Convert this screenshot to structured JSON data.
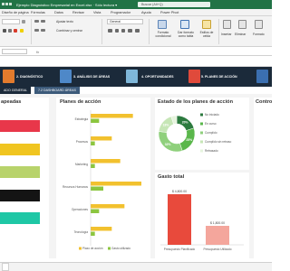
{
  "window": {
    "title": "Ejemplo Diagnóstico Empresarial en Excel.xlsx  ·  Sólo lectura ▾",
    "search_placeholder": "Buscar (Alt+Q)"
  },
  "ribbon_tabs": [
    "Diseño de página",
    "Fórmulas",
    "Datos",
    "Revisar",
    "Vista",
    "Programador",
    "Ayuda",
    "Power Pivot"
  ],
  "ribbon": {
    "font_name": "",
    "wrap_text": "Ajustar texto",
    "merge_center": "Combinar y centrar",
    "number_format": "General",
    "cond_format": "Formato condicional",
    "format_table": "Dar formato como tabla",
    "cell_styles": "Estilos de celda",
    "insert": "Insertar",
    "delete": "Eliminar",
    "format": "Formato"
  },
  "nav": {
    "items": [
      "2. DIAGNÓSTICO",
      "3. ANÁLISIS DE ÁREAS",
      "4. OPORTUNIDADES",
      "5. PLANES DE ACCIÓN"
    ],
    "tab_general": "ADO GENERAL",
    "tab_areas": "7.2 DASHBOARD ÁREAS"
  },
  "panels": {
    "left_title": "apeadas",
    "plans_title": "Planes de acción",
    "status_title": "Estado de los planes de acción",
    "spend_title": "Gasto total",
    "right_title": "Contro"
  },
  "colors": {
    "excel_green": "#217346",
    "nav_dark": "#1b2a3a",
    "bar_yellow": "#f2c12e",
    "bar_green": "#8cc63f",
    "spend_red": "#e84a3c",
    "spend_pink": "#f4a69c"
  },
  "left_bars": [
    {
      "color": "#e8374a"
    },
    {
      "color": "#f0c520"
    },
    {
      "color": "#b8d36b"
    },
    {
      "color": "#141414"
    },
    {
      "color": "#1ec7a5"
    }
  ],
  "chart_data": [
    {
      "type": "bar",
      "title": "Planes de acción",
      "categories": [
        "Estrategia",
        "Procesos",
        "Marketing",
        "Recursos Humanos",
        "Operaciones",
        "Tecnología"
      ],
      "series": [
        {
          "name": "Plazo de acción",
          "color": "#f2c12e",
          "values": [
            10,
            5,
            7,
            12,
            8,
            5
          ]
        },
        {
          "name": "Gasto utilizado",
          "color": "#8cc63f",
          "values": [
            2,
            1,
            1,
            3,
            2,
            1
          ]
        }
      ],
      "legend": [
        "Plazo de acción",
        "Gasto utilizado"
      ]
    },
    {
      "type": "pie",
      "title": "Estado de los planes de acción",
      "labels": [
        "No iniciado",
        "En curso",
        "Cumplido",
        "Cumplido sin retraso",
        "Retrasado"
      ],
      "colors": [
        "#2c7a3f",
        "#5ab74b",
        "#8fd07c",
        "#c6e6b6",
        "#e6f4de"
      ],
      "values": [
        20,
        25,
        32,
        18,
        5
      ],
      "slice_labels": [
        "20%",
        "25%",
        "32%",
        "18%"
      ]
    },
    {
      "type": "bar",
      "title": "Gasto total",
      "categories": [
        "Presupuesto Planificado",
        "Presupuesto Utilizado"
      ],
      "values": [
        4800,
        1800
      ],
      "value_labels": [
        "$ 4,800.00",
        "$ 1,800.00"
      ],
      "colors": [
        "#e84a3c",
        "#f4a69c"
      ]
    }
  ]
}
